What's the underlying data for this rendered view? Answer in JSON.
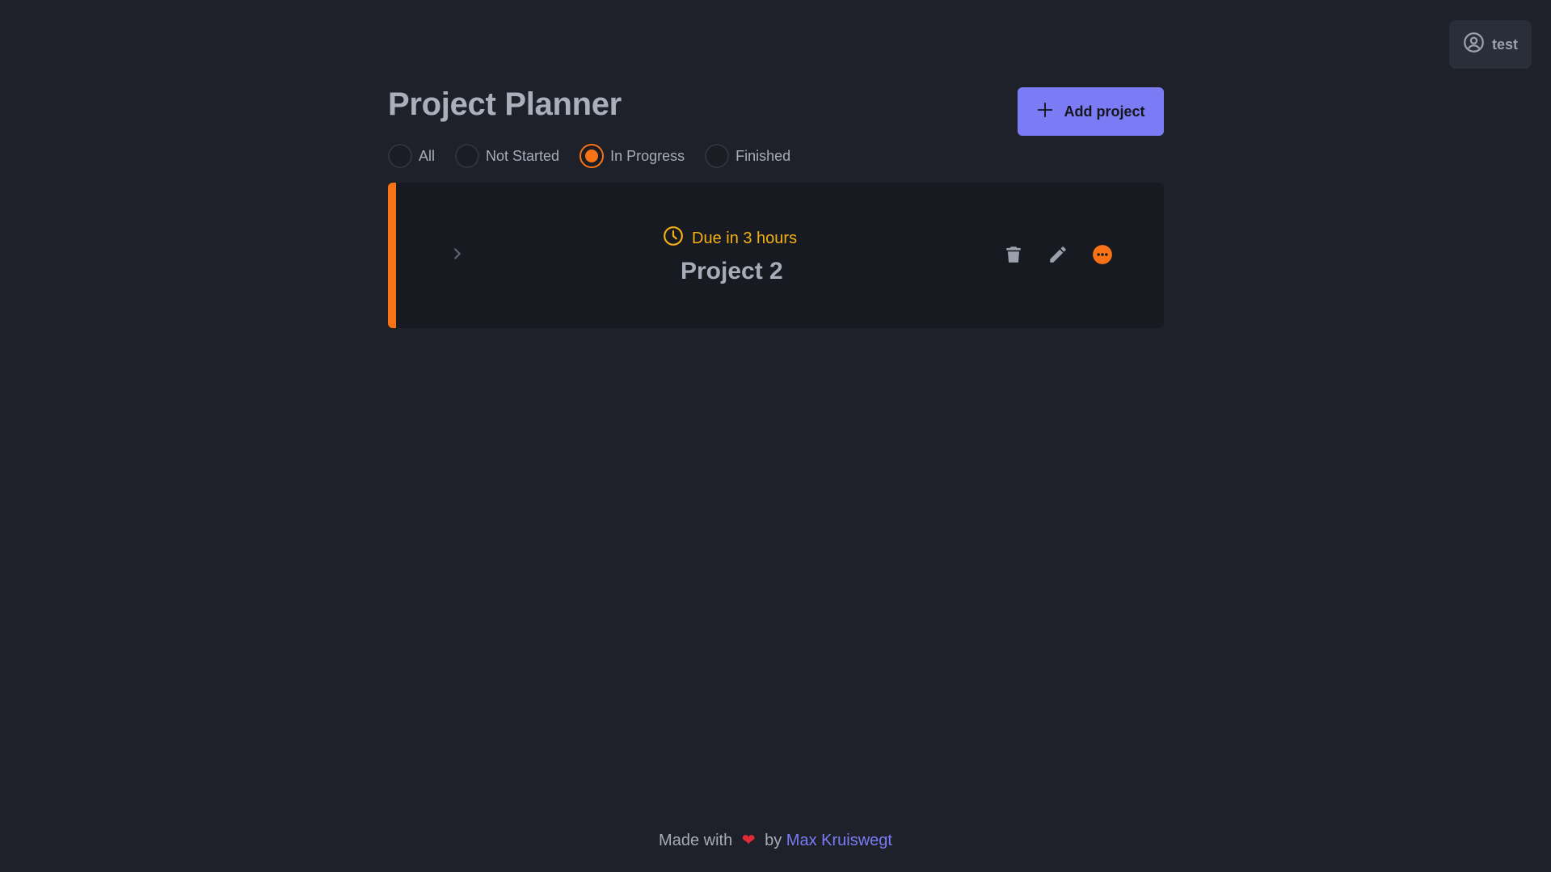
{
  "user": {
    "label": "test",
    "icon": "user-circle-icon"
  },
  "header": {
    "title": "Project Planner",
    "add_button_label": "Add project"
  },
  "filters": [
    {
      "label": "All",
      "checked": false
    },
    {
      "label": "Not Started",
      "checked": false
    },
    {
      "label": "In Progress",
      "checked": true
    },
    {
      "label": "Finished",
      "checked": false
    }
  ],
  "projects": [
    {
      "due": "Due in 3 hours",
      "name": "Project 2",
      "status_color": "#f97316",
      "actions": [
        "trash-icon",
        "pencil-icon",
        "more-icon"
      ]
    }
  ],
  "footer": {
    "prefix": "Made with",
    "heart": "❤",
    "by": "by",
    "author": "Max Kruiswegt"
  },
  "colors": {
    "accent": "#7b7cf5",
    "in_progress": "#f97316",
    "due": "#f5b013",
    "background": "#1e212a"
  }
}
